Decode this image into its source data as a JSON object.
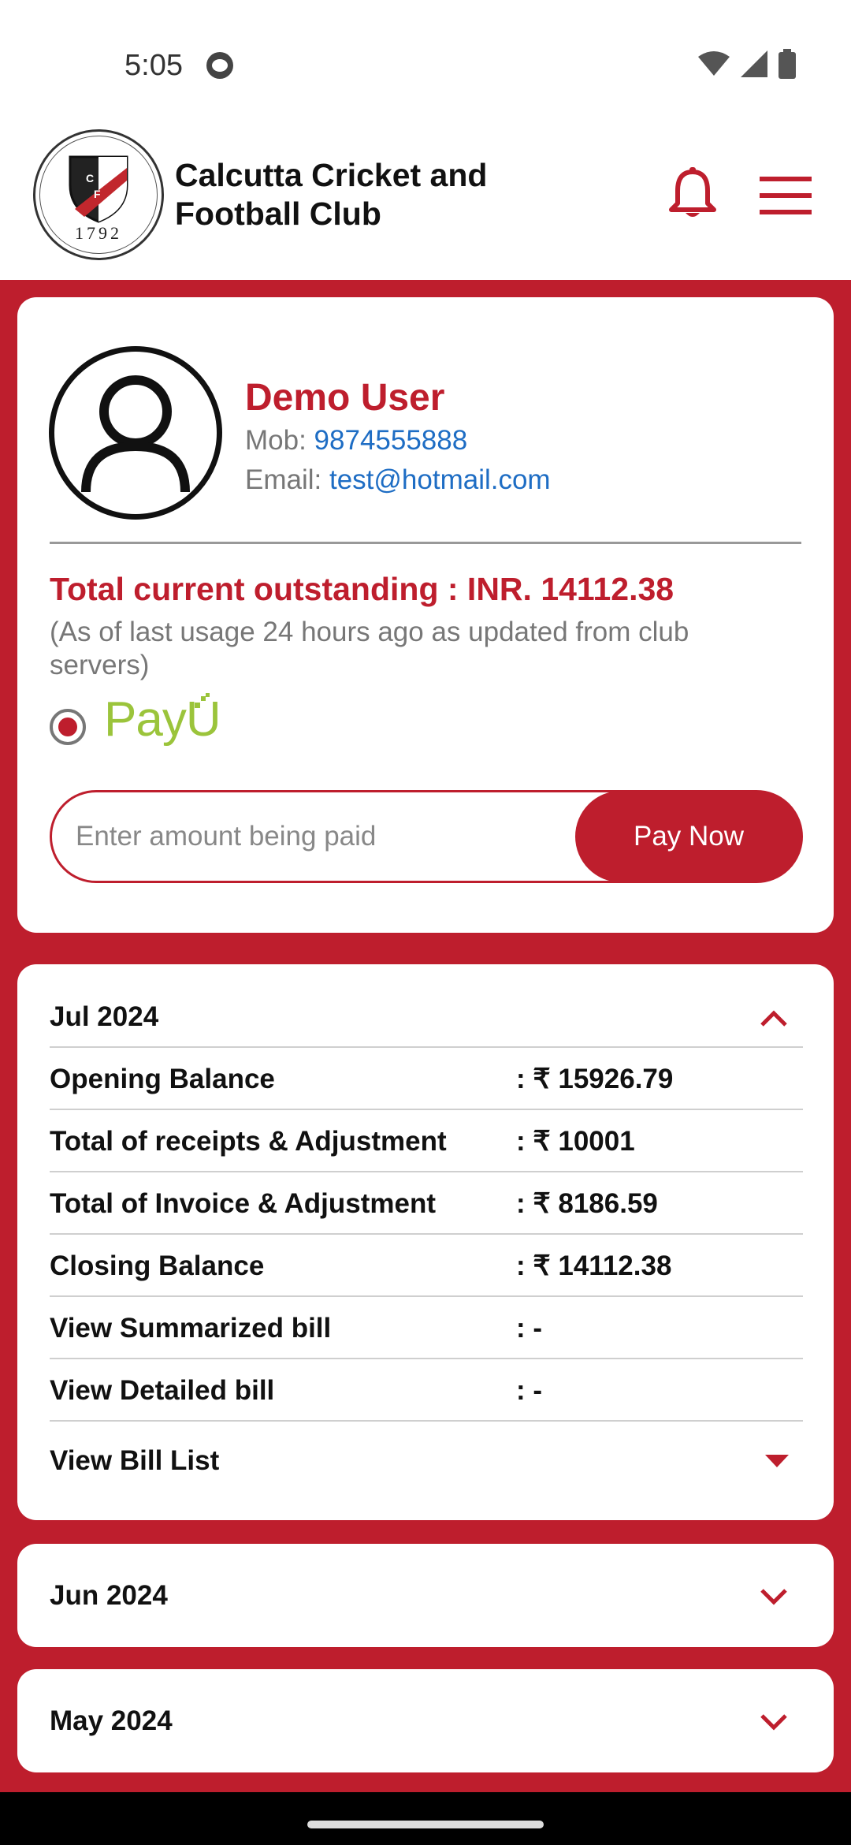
{
  "status": {
    "time": "5:05"
  },
  "header": {
    "club_name": "Calcutta Cricket and Football Club",
    "logo_year": "1792"
  },
  "profile": {
    "name": "Demo User",
    "mob_label": "Mob: ",
    "mob": "9874555888",
    "email_label": "Email: ",
    "email": "test@hotmail.com",
    "outstanding": "Total current outstanding : INR. 14112.38",
    "note": "(As of last usage 24 hours ago as updated from club servers)",
    "payment_method": "PayU",
    "amount_placeholder": "Enter amount being paid",
    "pay_button": "Pay Now"
  },
  "statement": {
    "month": "Jul 2024",
    "rows": [
      {
        "label": "Opening Balance",
        "value": ": ₹ 15926.79"
      },
      {
        "label": "Total of receipts & Adjustment",
        "value": ": ₹ 10001"
      },
      {
        "label": "Total of Invoice & Adjustment",
        "value": ": ₹ 8186.59"
      },
      {
        "label": "Closing Balance",
        "value": ": ₹ 14112.38"
      },
      {
        "label": "View Summarized bill",
        "value": ":  -"
      },
      {
        "label": "View Detailed bill",
        "value": ":  -"
      }
    ],
    "bill_list_label": "View Bill List"
  },
  "months": [
    {
      "label": "Jun 2024"
    },
    {
      "label": "May 2024"
    }
  ],
  "colors": {
    "brand_red": "#be1e2d",
    "link_blue": "#1e6dc4",
    "payu_green": "#9bc43b"
  }
}
